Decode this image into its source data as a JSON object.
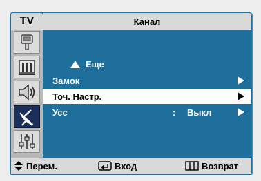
{
  "header": {
    "tab": "TV",
    "title": "Канал"
  },
  "sidebar": {
    "icons": [
      {
        "name": "input-icon",
        "selected": false
      },
      {
        "name": "picture-icon",
        "selected": false
      },
      {
        "name": "sound-icon",
        "selected": false
      },
      {
        "name": "channel-icon",
        "selected": true
      },
      {
        "name": "setup-icon",
        "selected": false
      }
    ]
  },
  "menu": {
    "more_label": "Еще",
    "items": [
      {
        "label": "Замок",
        "value": ""
      },
      {
        "label": "Точ. Настр.",
        "value": "",
        "selected": true
      },
      {
        "label": "Усс",
        "separator": ":",
        "value": "Выкл"
      }
    ]
  },
  "footer": {
    "move": "Перем.",
    "enter": "Вход",
    "return": "Возврат"
  },
  "colors": {
    "panel": "#1e6f9b",
    "bar": "#d9d9d9",
    "highlight": "#ffffff"
  }
}
